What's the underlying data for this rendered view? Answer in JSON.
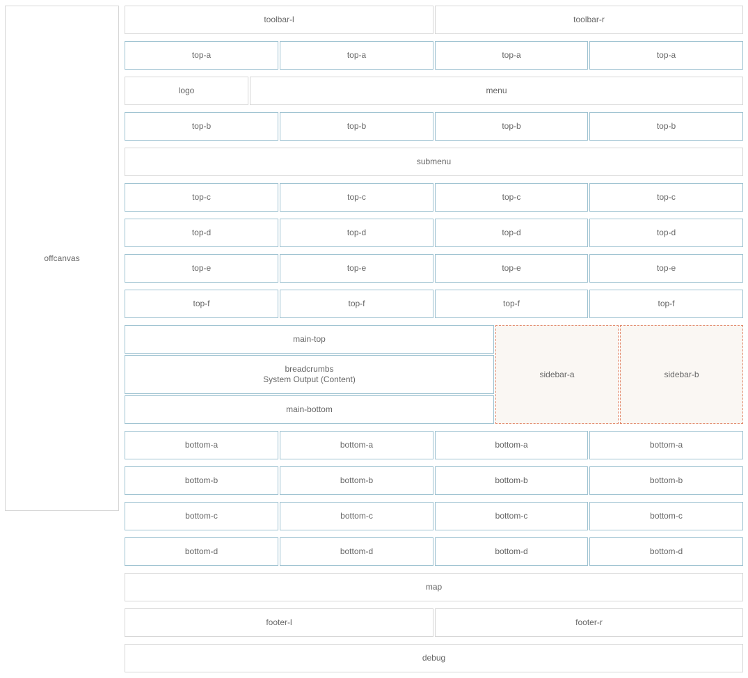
{
  "offcanvas": "offcanvas",
  "toolbar": {
    "left": "toolbar-l",
    "right": "toolbar-r"
  },
  "top_a": [
    "top-a",
    "top-a",
    "top-a",
    "top-a"
  ],
  "header": {
    "logo": "logo",
    "menu": "menu"
  },
  "top_b": [
    "top-b",
    "top-b",
    "top-b",
    "top-b"
  ],
  "submenu": "submenu",
  "top_c": [
    "top-c",
    "top-c",
    "top-c",
    "top-c"
  ],
  "top_d": [
    "top-d",
    "top-d",
    "top-d",
    "top-d"
  ],
  "top_e": [
    "top-e",
    "top-e",
    "top-e",
    "top-e"
  ],
  "top_f": [
    "top-f",
    "top-f",
    "top-f",
    "top-f"
  ],
  "main": {
    "top": "main-top",
    "breadcrumbs": "breadcrumbs",
    "content": "System Output (Content)",
    "bottom": "main-bottom"
  },
  "sidebar": {
    "a": "sidebar-a",
    "b": "sidebar-b"
  },
  "bottom_a": [
    "bottom-a",
    "bottom-a",
    "bottom-a",
    "bottom-a"
  ],
  "bottom_b": [
    "bottom-b",
    "bottom-b",
    "bottom-b",
    "bottom-b"
  ],
  "bottom_c": [
    "bottom-c",
    "bottom-c",
    "bottom-c",
    "bottom-c"
  ],
  "bottom_d": [
    "bottom-d",
    "bottom-d",
    "bottom-d",
    "bottom-d"
  ],
  "map": "map",
  "footer": {
    "left": "footer-l",
    "right": "footer-r"
  },
  "debug": "debug"
}
